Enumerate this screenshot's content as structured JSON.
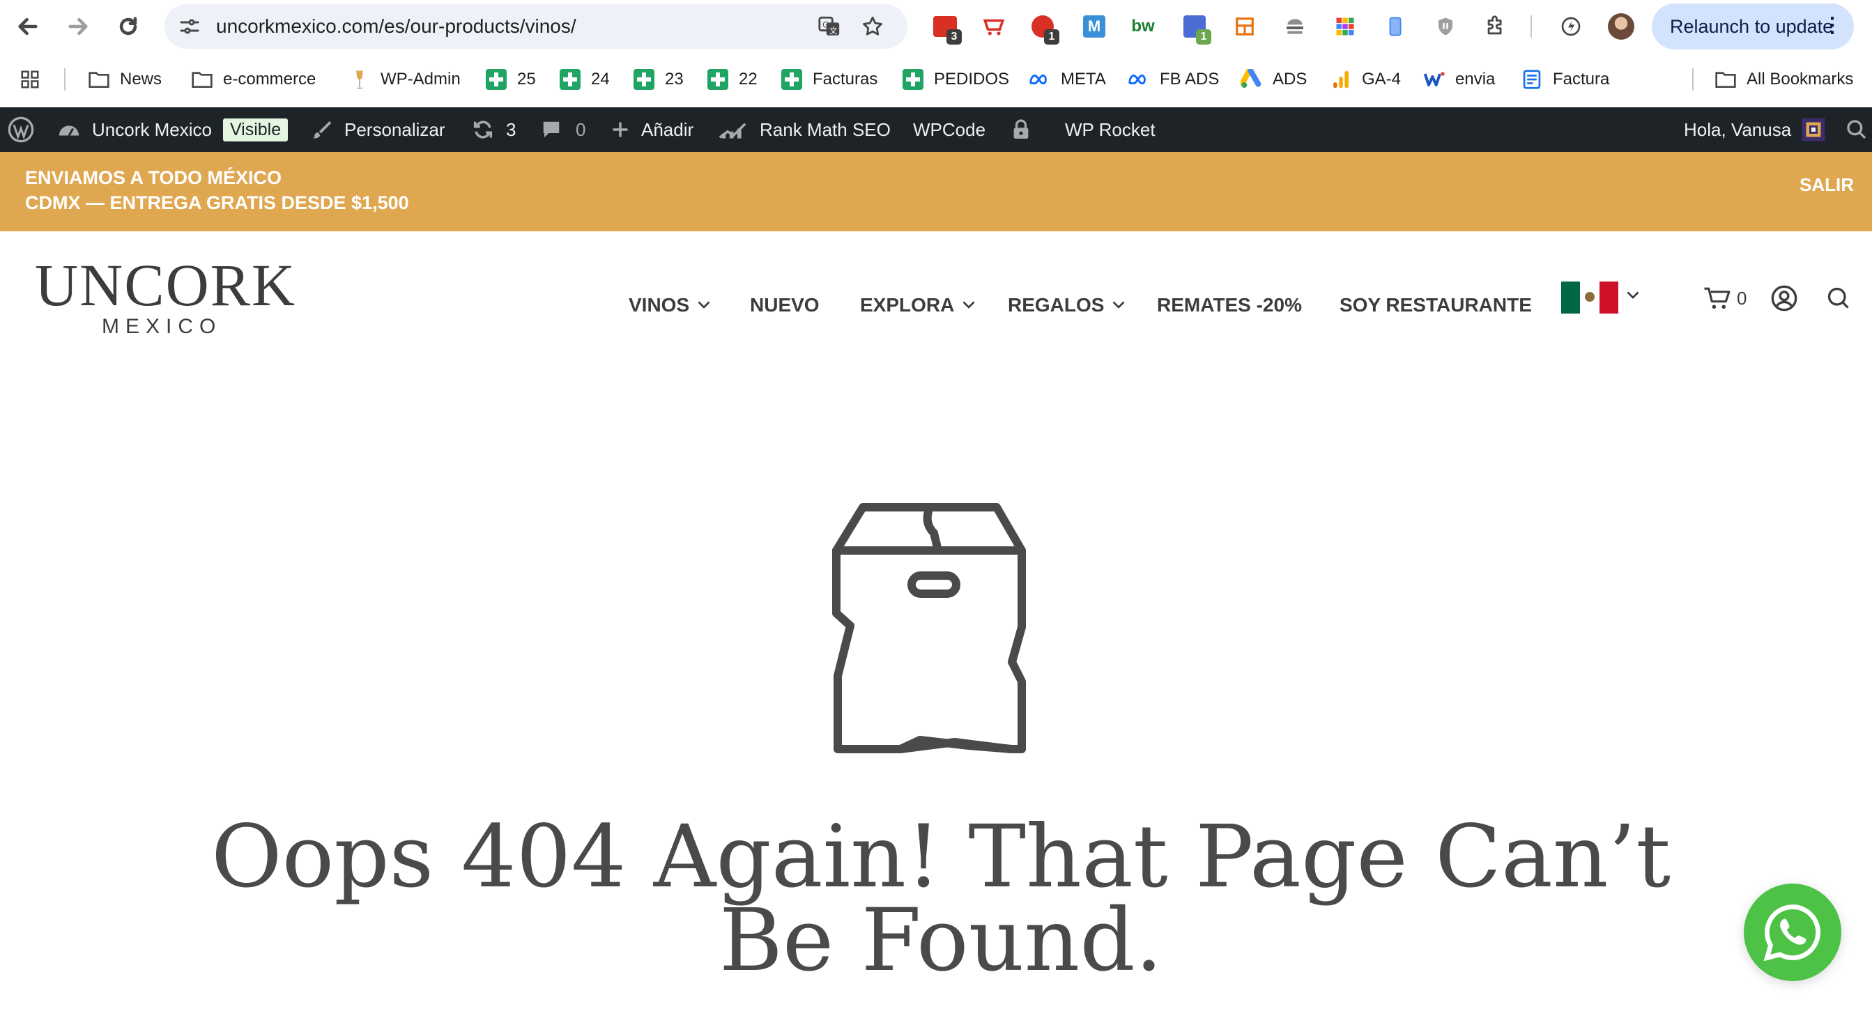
{
  "browser": {
    "url": "uncorkmexico.com/es/our-products/vinos/",
    "relaunch_label": "Relaunch to update",
    "extensions": [
      {
        "name": "ext-red-badge",
        "badge": "3"
      },
      {
        "name": "ext-red-cart",
        "badge": ""
      },
      {
        "name": "ext-red-g",
        "badge": "1"
      },
      {
        "name": "ext-m-blue",
        "badge": ""
      },
      {
        "name": "ext-bw",
        "badge": ""
      },
      {
        "name": "ext-code",
        "badge": "1"
      },
      {
        "name": "ext-layout",
        "badge": ""
      }
    ]
  },
  "bookmarks": {
    "items": [
      "News",
      "e-commerce",
      "WP-Admin",
      "25",
      "24",
      "23",
      "22",
      "Facturas",
      "PEDIDOS",
      "META",
      "FB ADS",
      "ADS",
      "GA-4",
      "envia",
      "Factura"
    ],
    "all_label": "All Bookmarks"
  },
  "wpbar": {
    "site_name": "Uncork Mexico",
    "visible_label": "Visible",
    "customize": "Personalizar",
    "updates": "3",
    "comments": "0",
    "add_new": "Añadir",
    "rankmath": "Rank Math SEO",
    "wpcode": "WPCode",
    "wprocket": "WP Rocket",
    "greeting": "Hola, Vanusa"
  },
  "announcement": {
    "line1": "ENVIAMOS A TODO MÉXICO",
    "line2": "CDMX — ENTREGA GRATIS DESDE $1,500",
    "close": "SALIR"
  },
  "header": {
    "logo": "UNCORK",
    "logo_sub": "MEXICO",
    "menu": [
      "VINOS",
      "NUEVO",
      "EXPLORA",
      "REGALOS",
      "REMATES -20%",
      "SOY RESTAURANTE"
    ],
    "cart_count": "0"
  },
  "content": {
    "title": "Oops 404 Again! That Page Can’t Be Found."
  },
  "colors": {
    "announcement_bg": "#e0a751",
    "wpbar_bg": "#1d2327",
    "text": "#3c3c3c",
    "whatsapp": "#4dc247",
    "relaunch_bg": "#d3e3fd"
  }
}
